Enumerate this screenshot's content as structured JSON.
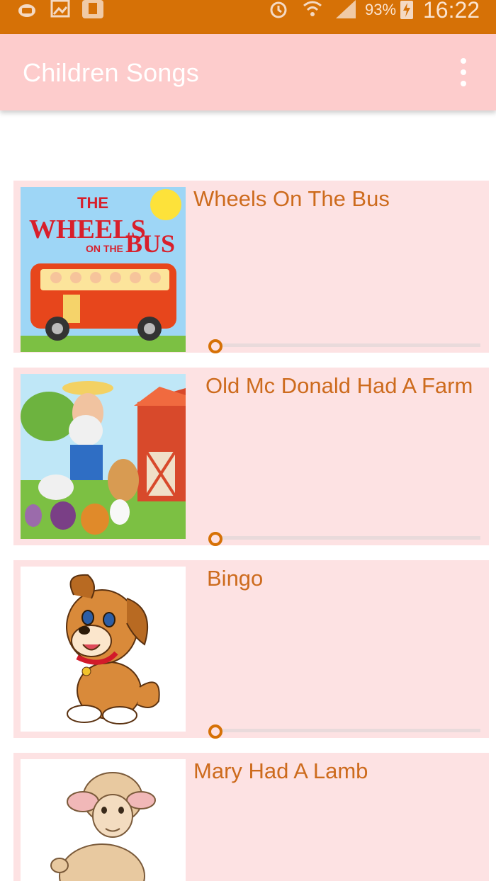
{
  "status_bar": {
    "battery": "93%",
    "time": "16:22",
    "icons": [
      "app-notification-icon",
      "image-icon",
      "sim-card-icon",
      "alarm-icon",
      "wifi-icon",
      "signal-icon",
      "battery-charging-icon"
    ]
  },
  "app_bar": {
    "title": "Children Songs",
    "overflow_icon": "more-vert-icon"
  },
  "songs": [
    {
      "title": "Wheels On The Bus",
      "thumbnail": "wheels-on-the-bus-art",
      "thumbnail_text": [
        "THE",
        "WHEELS",
        "ON THE",
        "BUS"
      ],
      "progress": 0
    },
    {
      "title": "Old Mc Donald Had A Farm",
      "thumbnail": "old-mcdonald-farm-art",
      "progress": 0
    },
    {
      "title": "Bingo",
      "thumbnail": "puppy-art",
      "progress": 0
    },
    {
      "title": "Mary Had A Lamb",
      "thumbnail": "lamb-art",
      "progress": 0
    }
  ],
  "colors": {
    "status_bar": "#d67106",
    "app_bar": "#fdcccc",
    "card_background": "#fde2e3",
    "title_text": "#cd6b1d",
    "seek_accent": "#d67106"
  }
}
